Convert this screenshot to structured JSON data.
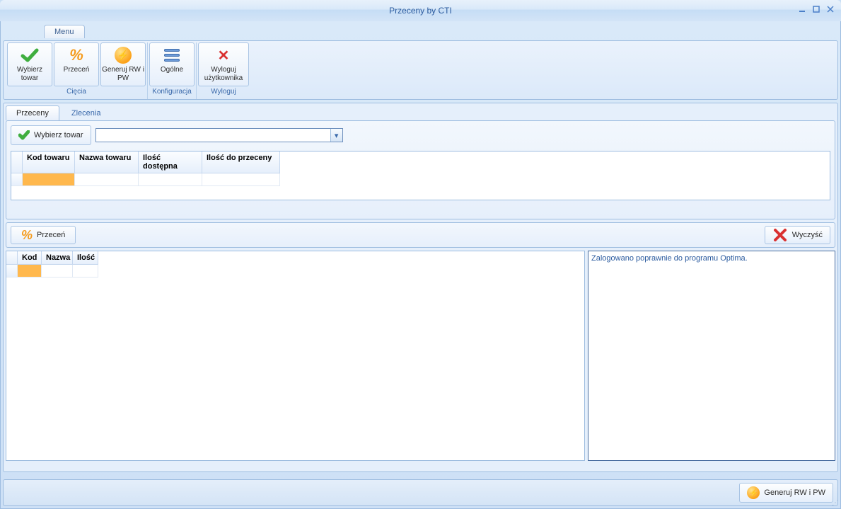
{
  "window": {
    "title": "Przeceny by CTI"
  },
  "menu": {
    "tab": "Menu"
  },
  "ribbon": {
    "groups": [
      {
        "label": "Cięcia",
        "buttons": [
          {
            "key": "wybierz-towar",
            "label": "Wybierz towar"
          },
          {
            "key": "przecen",
            "label": "Przeceń"
          },
          {
            "key": "generuj-rwpw",
            "label": "Generuj RW i PW"
          }
        ]
      },
      {
        "label": "Konfiguracja",
        "buttons": [
          {
            "key": "ogolne",
            "label": "Ogólne"
          }
        ]
      },
      {
        "label": "Wyloguj",
        "buttons": [
          {
            "key": "wyloguj",
            "label": "Wyloguj użytkownika"
          }
        ]
      }
    ]
  },
  "tabs": [
    {
      "key": "przeceny",
      "label": "Przeceny",
      "active": true
    },
    {
      "key": "zlecenia",
      "label": "Zlecenia",
      "active": false
    }
  ],
  "top": {
    "select_btn": "Wybierz towar",
    "combo_value": "",
    "columns": [
      "Kod towaru",
      "Nazwa towaru",
      "Ilość dostępna",
      "Ilość do przeceny"
    ]
  },
  "mid": {
    "przecen_btn": "Przeceń",
    "clear_btn": "Wyczyść"
  },
  "bottom": {
    "columns": [
      "Kod",
      "Nazwa",
      "Ilość"
    ],
    "log": "Zalogowano poprawnie do programu Optima."
  },
  "footer": {
    "generate_btn": "Generuj RW i PW"
  }
}
